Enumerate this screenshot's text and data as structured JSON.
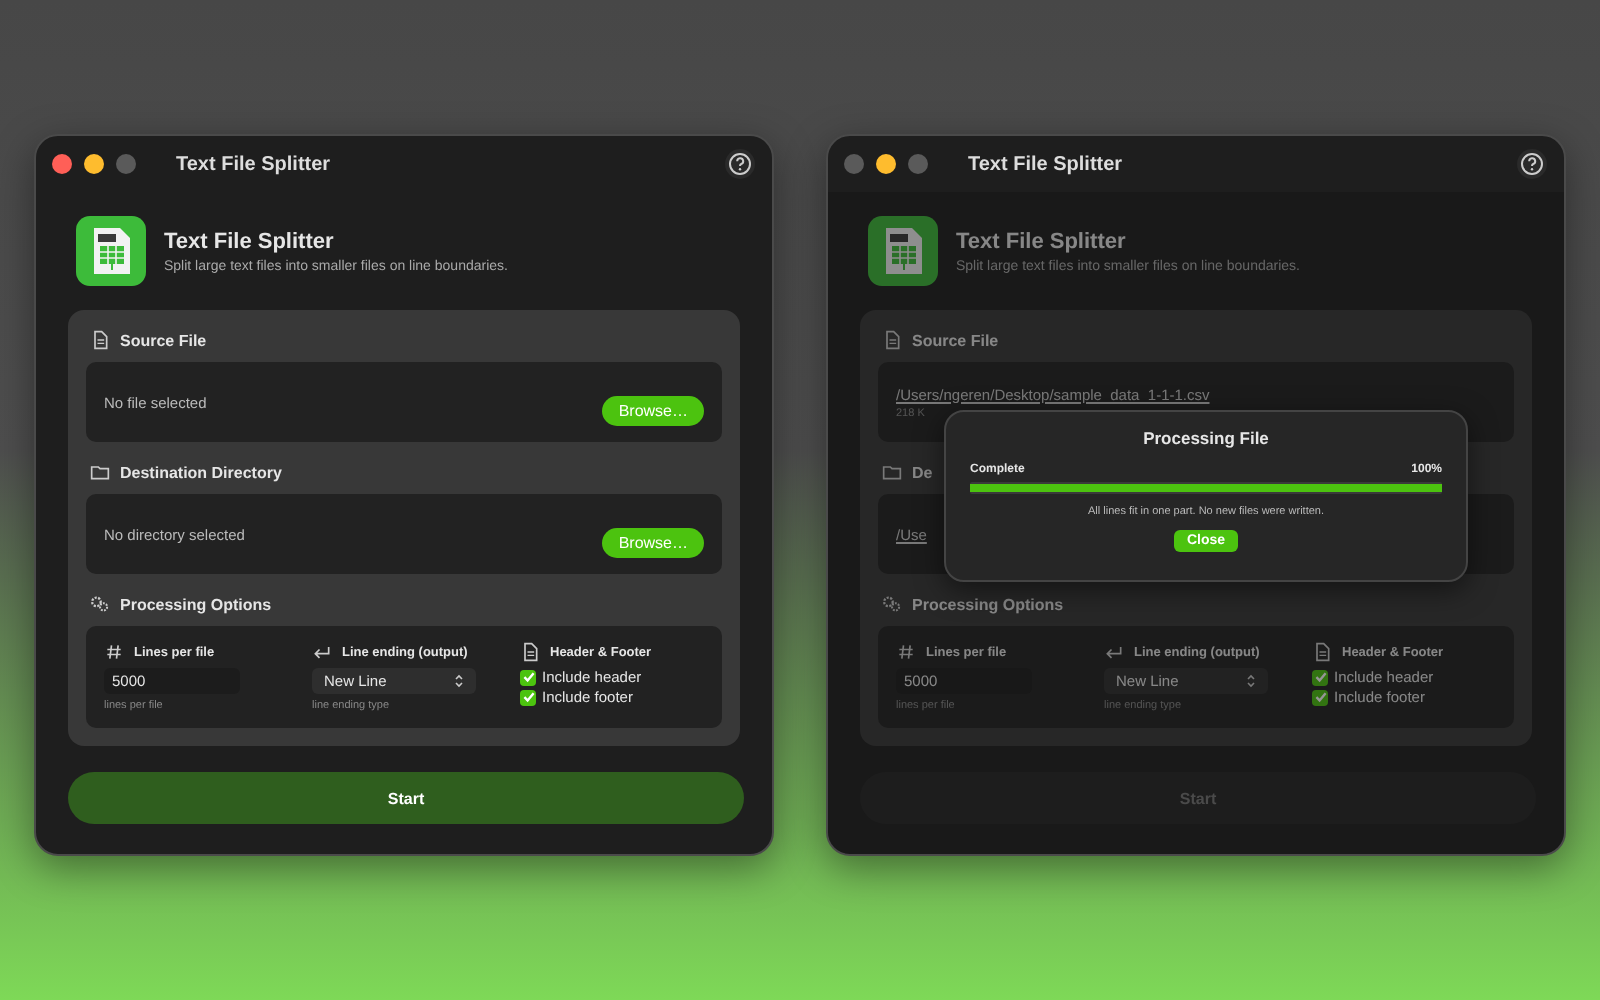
{
  "windows": [
    {
      "title": "Text File Splitter",
      "lights": [
        {
          "color": "#ff5f57"
        },
        {
          "color": "#febc2e"
        },
        {
          "color": "#5a5a5a"
        }
      ],
      "dimmed": false,
      "app": {
        "name": "Text File Splitter",
        "tagline": "Split large text files into smaller files on line boundaries."
      },
      "source": {
        "header": "Source File",
        "kind": "empty",
        "path": "No file selected",
        "browse": "Browse…"
      },
      "destination": {
        "header": "Destination Directory",
        "kind": "empty",
        "path": "No directory selected",
        "browse": "Browse…"
      },
      "options": {
        "header": "Processing Options",
        "lines": {
          "label": "Lines per file",
          "value": "5000",
          "hint": "lines per file"
        },
        "ending": {
          "label": "Line ending (output)",
          "value": "New Line",
          "hint": "line ending type"
        },
        "header_footer": {
          "label": "Header & Footer",
          "items": [
            {
              "label": "Include header",
              "checked": true
            },
            {
              "label": "Include footer",
              "checked": true
            }
          ]
        }
      },
      "start": {
        "label": "Start",
        "disabled": false
      }
    },
    {
      "title": "Text File Splitter",
      "lights": [
        {
          "color": "#5a5a5a"
        },
        {
          "color": "#febc2e"
        },
        {
          "color": "#5a5a5a"
        }
      ],
      "dimmed": true,
      "app": {
        "name": "Text File Splitter",
        "tagline": "Split large text files into smaller files on line boundaries."
      },
      "source": {
        "header": "Source File",
        "kind": "file",
        "path": "/Users/ngeren/Desktop/sample_data_1-1-1.csv",
        "size": "218 K"
      },
      "destination": {
        "header": "De",
        "kind": "file",
        "path": "/Use"
      },
      "options": {
        "header": "Processing Options",
        "lines": {
          "label": "Lines per file",
          "value": "5000",
          "hint": "lines per file"
        },
        "ending": {
          "label": "Line ending (output)",
          "value": "New Line",
          "hint": "line ending type"
        },
        "header_footer": {
          "label": "Header & Footer",
          "items": [
            {
              "label": "Include header",
              "checked": true
            },
            {
              "label": "Include footer",
              "checked": true
            }
          ]
        }
      },
      "start": {
        "label": "Start",
        "disabled": true
      },
      "dialog": {
        "title": "Processing File",
        "status": "Complete",
        "percent": "100%",
        "level": 1,
        "message": "All lines fit in one part. No new files were written.",
        "button": "Close"
      }
    }
  ]
}
